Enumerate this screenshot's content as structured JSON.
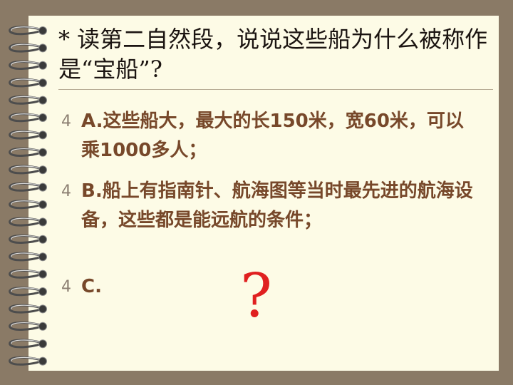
{
  "slide": {
    "title": "* 读第二自然段，说说这些船为什么被称作是“宝船”?",
    "bullets": [
      {
        "marker": "4",
        "text": "A.这些船大，最大的长150米，宽60米，可以乘1000多人；"
      },
      {
        "marker": "4",
        "text": "B.船上有指南针、航海图等当时最先进的航海设备，这些都是能远航的条件；"
      },
      {
        "marker": "4",
        "text": "C."
      }
    ],
    "question_mark": "?"
  },
  "colors": {
    "background": "#8a7a66",
    "paper": "#fdfbe6",
    "title_text": "#1b1411",
    "bullet_text": "#77482a",
    "accent_red": "#e02020"
  },
  "decor": {
    "binding": "spiral-notebook-rings"
  }
}
